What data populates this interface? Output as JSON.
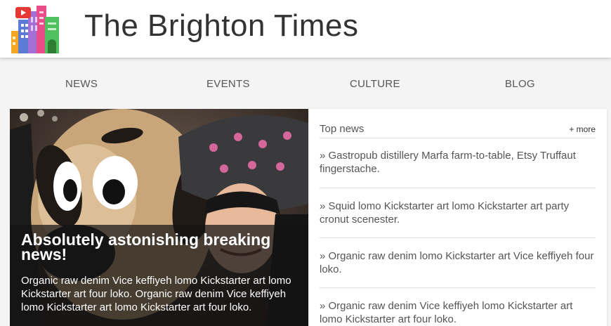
{
  "header": {
    "title": "The Brighton Times",
    "logo_icon": "city-buildings-logo"
  },
  "nav": {
    "items": [
      "NEWS",
      "EVENTS",
      "CULTURE",
      "BLOG"
    ]
  },
  "hero": {
    "title": "Absolutely astonishing breaking news!",
    "text": "Organic raw denim Vice keffiyeh lomo Kickstarter art lomo Kickstarter art four loko. Organic raw denim Vice keffiyeh lomo Kickstarter art lomo Kickstarter art four loko."
  },
  "top_news": {
    "title": "Top news",
    "more_label": "+ more",
    "items": [
      "» Gastropub distillery Marfa farm-to-table, Etsy Truffaut fingerstache.",
      "» Squid lomo Kickstarter art lomo Kickstarter art party cronut scenester.",
      "» Organic raw denim lomo Kickstarter art Vice keffiyeh four loko.",
      "» Organic raw denim Vice keffiyeh lomo Kickstarter art lomo Kickstarter art four loko."
    ]
  },
  "colors": {
    "page_bg": "#f4f4f4",
    "title_text": "#333333",
    "nav_text": "#555555",
    "overlay": "#141414"
  }
}
